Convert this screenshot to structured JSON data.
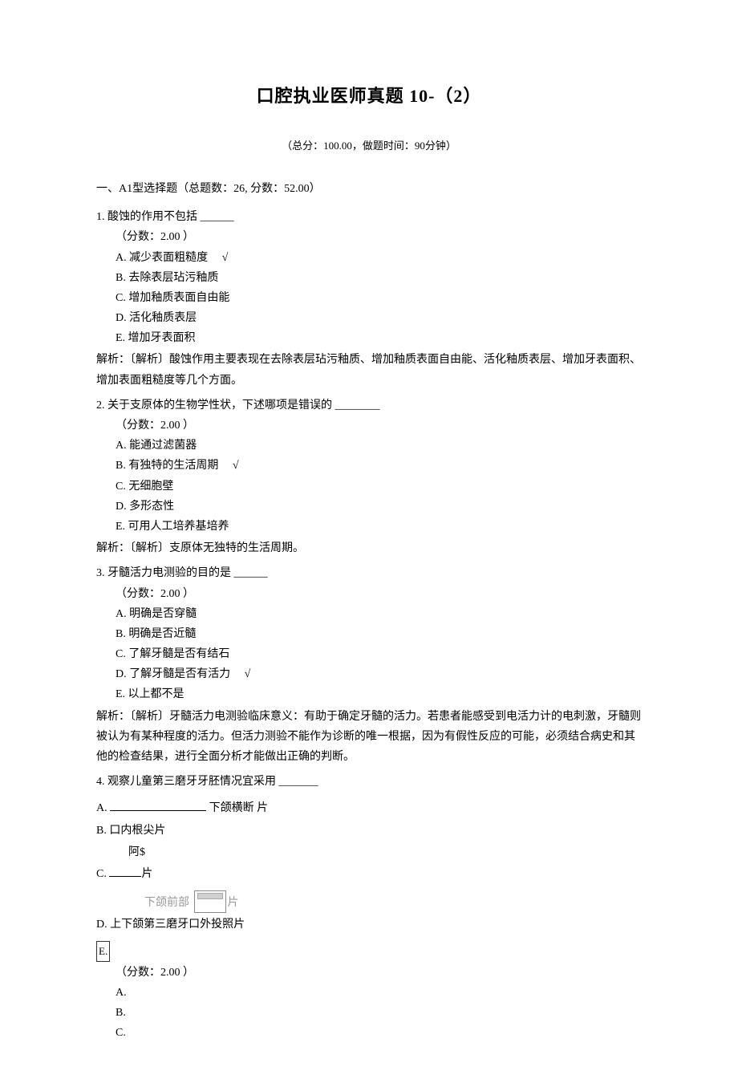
{
  "title": "口腔执业医师真题  10-（2）",
  "subtitle": "（总分：100.00，做题时间：90分钟）",
  "section": "一、A1型选择题（总题数：26, 分数：52.00）",
  "q1": {
    "stem": "1.  酸蚀的作用不包括 ______",
    "score": "（分数：2.00 ）",
    "A": "A.  减少表面粗糙度",
    "A_chk": "√",
    "B": "B.  去除表层玷污釉质",
    "C": "C.  增加釉质表面自由能",
    "D": "D.  活化釉质表层",
    "E": "E.  增加牙表面积",
    "explain": "解析：〔解析〕酸蚀作用主要表现在去除表层玷污釉质、增加釉质表面自由能、活化釉质表层、增加牙表面积、增加表面粗糙度等几个方面。"
  },
  "q2": {
    "stem": "2.  关于支原体的生物学性状，下述哪项是错误的  ________",
    "score": "（分数：2.00 ）",
    "A": "A.  能通过滤菌器",
    "B": "B.  有独特的生活周期",
    "B_chk": "√",
    "C": "C.  无细胞壁",
    "D": "D.  多形态性",
    "E": "E.  可用人工培养基培养",
    "explain": "解析：〔解析〕支原体无独特的生活周期。"
  },
  "q3": {
    "stem": "3.  牙髓活力电测验的目的是  ______",
    "score": "（分数：2.00 ）",
    "A": "A.  明确是否穿髓",
    "B": "B.  明确是否近髓",
    "C": "C.  了解牙髓是否有结石",
    "D": "D.  了解牙髓是否有活力",
    "D_chk": "√",
    "E": "E.  以上都不是",
    "explain": "解析：〔解析〕牙髓活力电测验临床意义：有助于确定牙髓的活力。若患者能感受到电活力计的电刺激，牙髓则被认为有某种程度的活力。但活力测验不能作为诊断的唯一根据，因为有假性反应的可能，必须结合病史和其他的检查结果，进行全面分析才能做出正确的判断。"
  },
  "q4": {
    "stem": "4.  观察儿童第三磨牙牙胚情况宜采用  _______",
    "A_pre": "A.  ",
    "A_post": " 下颌横断         片",
    "B": "B.      口内根尖片",
    "B2": "阿$",
    "C_pre": "C.   ",
    "C_post": "片",
    "img_label_pre": "下颌前部 ",
    "img_label_post": "片",
    "D": "D.  上下颌第三磨牙口外投照片",
    "E": "E.",
    "score": "（分数：2.00 ）",
    "aa": "A.",
    "bb": "B.",
    "cc": "C."
  }
}
